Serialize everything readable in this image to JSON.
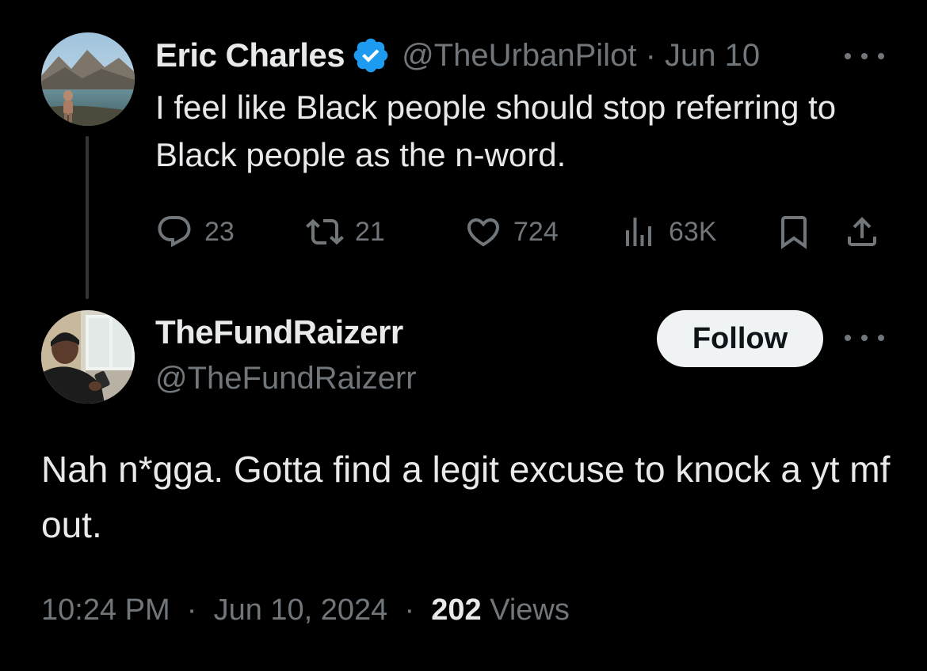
{
  "parent_tweet": {
    "display_name": "Eric Charles",
    "verified": true,
    "handle": "@TheUrbanPilot",
    "date": "Jun 10",
    "text": "I feel like Black people should stop referring to Black people as the n-word.",
    "stats": {
      "replies": "23",
      "reposts": "21",
      "likes": "724",
      "views": "63K"
    },
    "icons": [
      "reply-icon",
      "repost-icon",
      "like-icon",
      "views-icon",
      "bookmark-icon",
      "share-icon",
      "more-icon",
      "verified-icon"
    ]
  },
  "reply_tweet": {
    "display_name": "TheFundRaizerr",
    "handle": "@TheFundRaizerr",
    "follow_label": "Follow",
    "text": "Nah n*gga. Gotta find a legit excuse to knock a yt mf out.",
    "time": "10:24 PM",
    "date": "Jun 10, 2024",
    "views_count": "202",
    "views_label": "Views"
  },
  "separator": "·",
  "colors": {
    "background": "#000000",
    "primary_text": "#e7e9ea",
    "secondary_text": "#71767b",
    "verified_blue": "#1d9bf0",
    "follow_button_bg": "#eff3f4",
    "thread_line": "#333639"
  }
}
